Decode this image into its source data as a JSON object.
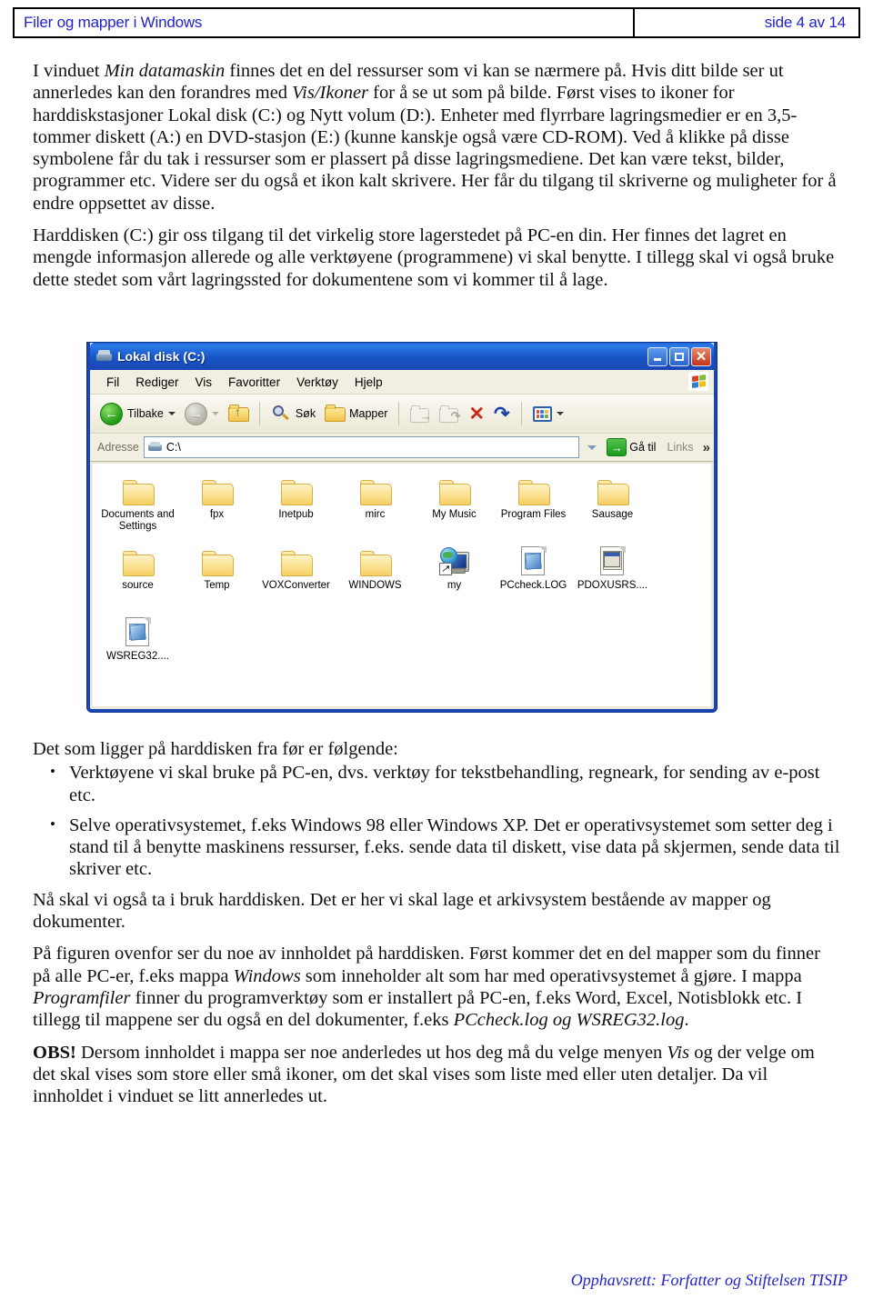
{
  "header": {
    "title": "Filer og mapper i Windows",
    "page_indicator": "side 4 av 14",
    "link_color": "#2222cc"
  },
  "paragraphs": {
    "p1_a": "I vinduet ",
    "p1_b": "Min datamaskin",
    "p1_c": " finnes det en del ressurser som vi kan se nærmere på. Hvis ditt bilde ser ut annerledes kan den forandres med ",
    "p1_d": "Vis/Ikoner",
    "p1_e": " for å se ut som på bilde. Først vises to ikoner for harddiskstasjoner Lokal disk (C:) og Nytt volum (D:). Enheter med flyrrbare lagringsmedier er en 3,5-tommer diskett (A:) en  DVD-stasjon (E:) (kunne kanskje også være CD-ROM). Ved å klikke på disse symbolene får du tak i ressurser som er plassert på disse lagringsmediene. Det kan være tekst, bilder, programmer etc. Videre ser du også et ikon kalt skrivere. Her får du tilgang til skriverne og muligheter for å endre oppsettet av disse.",
    "p2": "Harddisken (C:) gir oss tilgang til det virkelig store lagerstedet på PC-en din. Her finnes det lagret en mengde informasjon allerede og alle verktøyene (programmene) vi skal benytte. I tillegg skal vi også bruke dette stedet som vårt lagringssted for dokumentene som vi kommer til å lage.",
    "p3": "Det som ligger på harddisken fra før er følgende:",
    "bullet1": "Verktøyene vi skal bruke på PC-en, dvs. verktøy for tekstbehandling, regneark, for sending av e-post etc.",
    "bullet2": "Selve operativsystemet, f.eks Windows 98 eller Windows XP. Det er operativsystemet som setter deg i stand til å benytte maskinens ressurser, f.eks. sende data til diskett, vise data på skjermen, sende data til skriver etc.",
    "p4": "Nå skal vi også ta i bruk harddisken. Det er her vi skal lage et arkivsystem bestående av mapper og dokumenter.",
    "p5_a": "På figuren ovenfor ser du noe av innholdet på harddisken. Først kommer det en del mapper som du finner på alle PC-er, f.eks mappa ",
    "p5_b": "Windows",
    "p5_c": " som inneholder alt som har med operativsystemet å gjøre. I mappa ",
    "p5_d": "Programfiler",
    "p5_e": " finner du programverktøy som er installert på PC-en, f.eks Word, Excel, Notisblokk etc. I tillegg til mappene ser du også en del dokumenter, f.eks ",
    "p5_f": "PCcheck.log og WSREG32.log",
    "p5_g": ".",
    "p6_a": "OBS!",
    "p6_b": " Dersom innholdet i mappa ser noe anderledes ut hos deg må du velge menyen ",
    "p6_c": "Vis",
    "p6_d": " og der velge om det skal vises som store eller små ikoner, om det skal vises som liste med eller uten detaljer. Da vil innholdet i vinduet se litt annerledes ut."
  },
  "explorer": {
    "window_title": "Lokal disk (C:)",
    "title_icon": "hard-drive-icon",
    "window_buttons": {
      "minimize": "minimize-button",
      "maximize": "maximize-button",
      "close": "close-button",
      "close_glyph": "✕"
    },
    "menu": [
      {
        "label": "Fil",
        "accel": "F"
      },
      {
        "label": "Rediger",
        "accel": "R"
      },
      {
        "label": "Vis",
        "accel": "V"
      },
      {
        "label": "Favoritter",
        "accel": "a"
      },
      {
        "label": "Verktøy",
        "accel": "r"
      },
      {
        "label": "Hjelp",
        "accel": "H"
      }
    ],
    "windows_flag_colors": [
      "#e03c20",
      "#7bc043",
      "#2a7fd4",
      "#f5c015"
    ],
    "toolbar": {
      "back_label": "Tilbake",
      "forward_label": "",
      "up_label": "",
      "search_label": "Søk",
      "folders_label": "Mapper",
      "move_to_label": "",
      "copy_to_label": "",
      "delete_label": "",
      "undo_label": "",
      "views_label": "",
      "view_swatches": [
        "#e4453c",
        "#3b7fd4",
        "#f2c044",
        "#e4453c",
        "#3b7fd4",
        "#6ab04c"
      ]
    },
    "address": {
      "label": "Adresse",
      "value": "C:\\",
      "go_label": "Gå til",
      "go_arrow": "→",
      "links_label": "Links",
      "chevron": "»"
    },
    "files": [
      {
        "name": "Documents and Settings",
        "type": "folder"
      },
      {
        "name": "fpx",
        "type": "folder"
      },
      {
        "name": "Inetpub",
        "type": "folder"
      },
      {
        "name": "mirc",
        "type": "folder"
      },
      {
        "name": "My Music",
        "type": "folder"
      },
      {
        "name": "Program Files",
        "type": "folder"
      },
      {
        "name": "Sausage",
        "type": "folder"
      },
      {
        "name": "source",
        "type": "folder"
      },
      {
        "name": "Temp",
        "type": "folder"
      },
      {
        "name": "VOXConverter",
        "type": "folder"
      },
      {
        "name": "WINDOWS",
        "type": "folder"
      },
      {
        "name": "my",
        "type": "shortcut"
      },
      {
        "name": "PCcheck.LOG",
        "type": "document"
      },
      {
        "name": "PDOXUSRS....",
        "type": "pdox"
      },
      {
        "name": "WSREG32....",
        "type": "document"
      }
    ]
  },
  "footer": {
    "text": "Opphavsrett:  Forfatter og Stiftelsen TISIP"
  }
}
